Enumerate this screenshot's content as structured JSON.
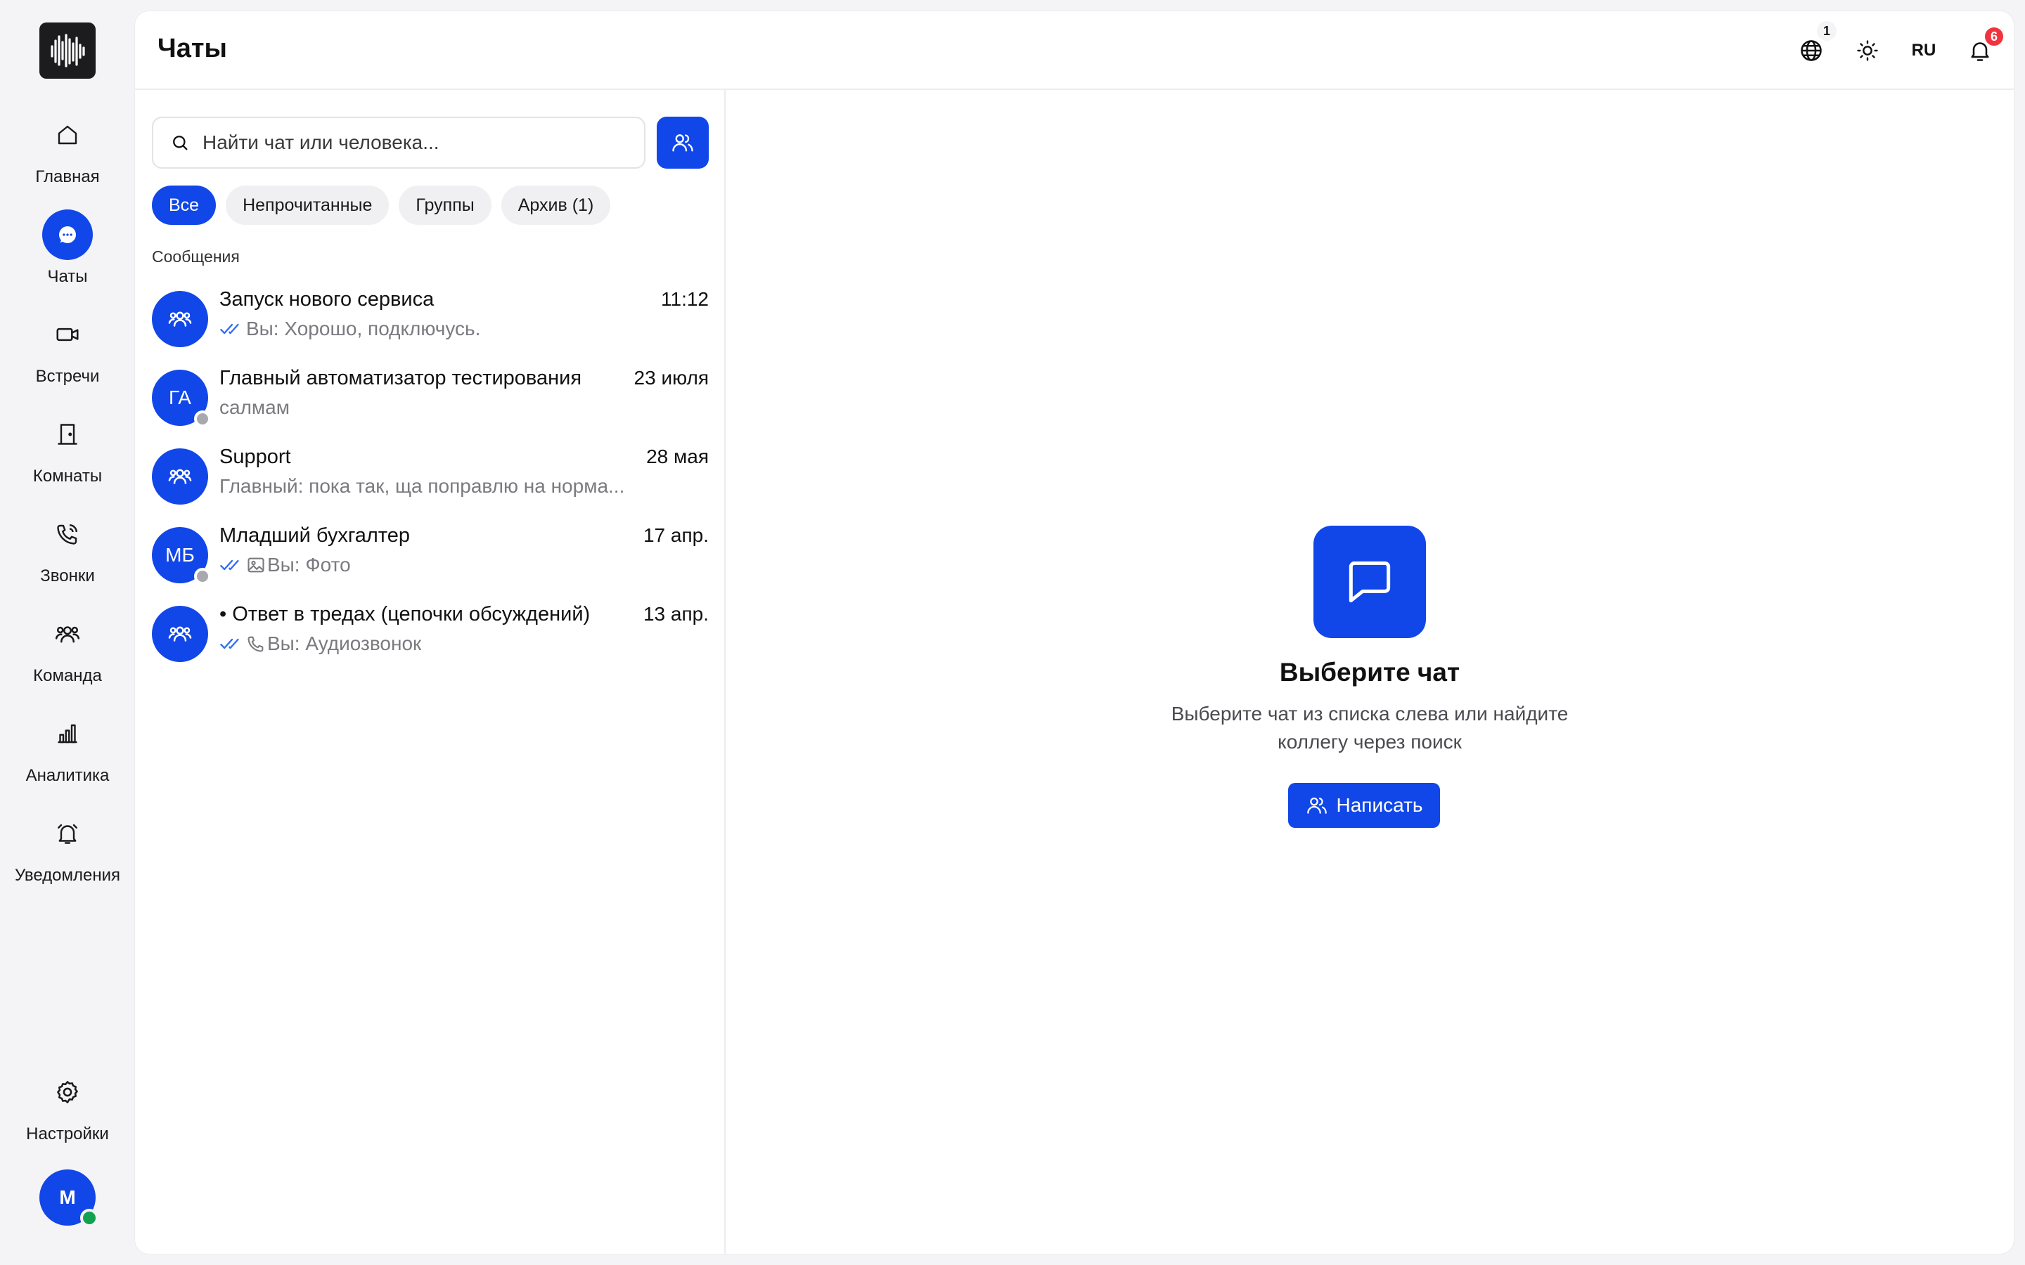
{
  "sidebar": {
    "items": [
      {
        "label": "Главная",
        "icon": "home-icon"
      },
      {
        "label": "Чаты",
        "icon": "chat-bubble-icon",
        "active": true
      },
      {
        "label": "Встречи",
        "icon": "video-camera-icon"
      },
      {
        "label": "Комнаты",
        "icon": "door-icon"
      },
      {
        "label": "Звонки",
        "icon": "phone-icon"
      },
      {
        "label": "Команда",
        "icon": "users-icon"
      },
      {
        "label": "Аналитика",
        "icon": "bar-chart-icon"
      },
      {
        "label": "Уведомления",
        "icon": "alarm-bell-icon"
      }
    ],
    "settings_label": "Настройки",
    "user_initial": "M",
    "user_status": "online"
  },
  "header": {
    "title": "Чаты",
    "globe_badge": "1",
    "language": "RU",
    "notifications_badge": "6"
  },
  "search": {
    "placeholder": "Найти чат или человека..."
  },
  "filters": [
    {
      "label": "Все",
      "active": true
    },
    {
      "label": "Непрочитанные",
      "active": false
    },
    {
      "label": "Группы",
      "active": false
    },
    {
      "label": "Архив (1)",
      "active": false
    }
  ],
  "section_label": "Сообщения",
  "chats": [
    {
      "name": "Запуск нового сервиса",
      "time": "11:12",
      "preview": "Вы: Хорошо, подключусь.",
      "avatar": "group",
      "read": true,
      "attachment": null
    },
    {
      "name": "Главный автоматизатор тестирования",
      "time": "23 июля",
      "preview": "салмам",
      "avatar": "ГА",
      "read": false,
      "attachment": null,
      "status": "offline"
    },
    {
      "name": "Support",
      "time": "28 мая",
      "preview": "Главный: пока так, ща поправлю на норма...",
      "avatar": "group",
      "read": false,
      "attachment": null
    },
    {
      "name": "Младший бухгалтер",
      "time": "17 апр.",
      "preview": "Вы: Фото",
      "avatar": "МБ",
      "read": true,
      "attachment": "image",
      "status": "offline"
    },
    {
      "name": "• Ответ в тредах (цепочки обсуждений)",
      "time": "13 апр.",
      "preview": "Вы: Аудиозвонок",
      "avatar": "group",
      "read": true,
      "attachment": "call"
    }
  ],
  "empty_state": {
    "title": "Выберите чат",
    "description": "Выберите чат из списка слева или найдите коллегу через поиск",
    "button_label": "Написать"
  },
  "colors": {
    "accent": "#1147e8",
    "badge_red": "#f0343f",
    "online_green": "#12a150",
    "read_check_blue": "#2f6df6"
  }
}
